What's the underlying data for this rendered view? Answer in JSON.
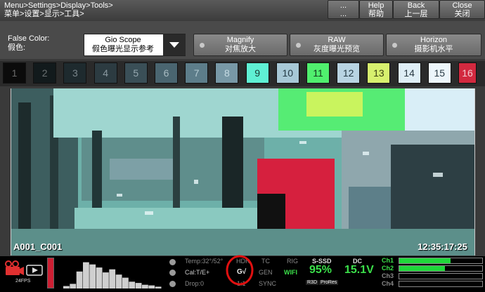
{
  "breadcrumb": {
    "en": "Menu>Settings>Display>Tools>",
    "zh": "菜单>设置>显示>工具>"
  },
  "topbar": {
    "blank1": {
      "line1": "...",
      "line2": "..."
    },
    "blank2": {
      "line1": "...",
      "line2": "..."
    },
    "help": {
      "en": "Help",
      "zh": "帮助"
    },
    "back": {
      "en": "Back",
      "zh": "上一层"
    },
    "close": {
      "en": "Close",
      "zh": "关闭"
    }
  },
  "false_color": {
    "label_en": "False Color:",
    "label_zh": "假色:",
    "selected_en": "Gio Scope",
    "selected_zh": "假色曝光显示参考"
  },
  "options": [
    {
      "en": "Magnify",
      "zh": "对焦放大"
    },
    {
      "en": "RAW",
      "zh": "灰度曝光预览"
    },
    {
      "en": "Horizon",
      "zh": "摄影机水平"
    }
  ],
  "scale": [
    {
      "label": "1",
      "bg": "#0b0b0b",
      "fg": "#6a6a6a"
    },
    {
      "label": "2",
      "bg": "#121a1c",
      "fg": "#6a7072"
    },
    {
      "label": "3",
      "bg": "#1e2a2e",
      "fg": "#79858a"
    },
    {
      "label": "4",
      "bg": "#2c3b41",
      "fg": "#8a98a0"
    },
    {
      "label": "5",
      "bg": "#3a4f57",
      "fg": "#96a8b0"
    },
    {
      "label": "6",
      "bg": "#4a6570",
      "fg": "#a9bcc3"
    },
    {
      "label": "7",
      "bg": "#5d7d8a",
      "fg": "#b4cad2"
    },
    {
      "label": "8",
      "bg": "#7898a6",
      "fg": "#c6dce4"
    },
    {
      "label": "9",
      "bg": "#5ff0d4",
      "fg": "#1b3a34"
    },
    {
      "label": "10",
      "bg": "#a7c8d6",
      "fg": "#243a44"
    },
    {
      "label": "11",
      "bg": "#50ef6e",
      "fg": "#123a1c"
    },
    {
      "label": "12",
      "bg": "#b8d4e2",
      "fg": "#243a44"
    },
    {
      "label": "13",
      "bg": "#d7f06e",
      "fg": "#3a4010"
    },
    {
      "label": "14",
      "bg": "#dfeef6",
      "fg": "#2a3a44"
    },
    {
      "label": "15",
      "bg": "#edf6fb",
      "fg": "#2a3a44"
    },
    {
      "label": "16",
      "bg": "#d2293f",
      "fg": "#f4c8cf"
    }
  ],
  "viewer": {
    "clip_name": "A001_C001",
    "timecode": "12:35:17:25"
  },
  "status": {
    "fps": "24FPS",
    "temp": "Temp:32°/52°",
    "cal": "Cal:T/E+",
    "drop": "Drop:0",
    "hdr": "HDR",
    "g": "G√",
    "ratio": "1:1",
    "tc": "TC",
    "gen": "GEN",
    "sync": "SYNC",
    "rig": "RIG",
    "wifi": "WIFI",
    "ssd_label": "S-SSD",
    "ssd_value": "95%",
    "r3d": "R3D",
    "prores": "ProRes",
    "dc_label": "DC",
    "dc_value": "15.1V",
    "channels": [
      {
        "label": "Ch1",
        "level": 0.62
      },
      {
        "label": "Ch2",
        "level": 0.55
      },
      {
        "label": "Ch3",
        "level": 0
      },
      {
        "label": "Ch4",
        "level": 0
      }
    ],
    "histogram": [
      0.08,
      0.15,
      0.55,
      0.85,
      0.78,
      0.68,
      0.52,
      0.62,
      0.45,
      0.35,
      0.22,
      0.18,
      0.12,
      0.1,
      0.06
    ]
  }
}
